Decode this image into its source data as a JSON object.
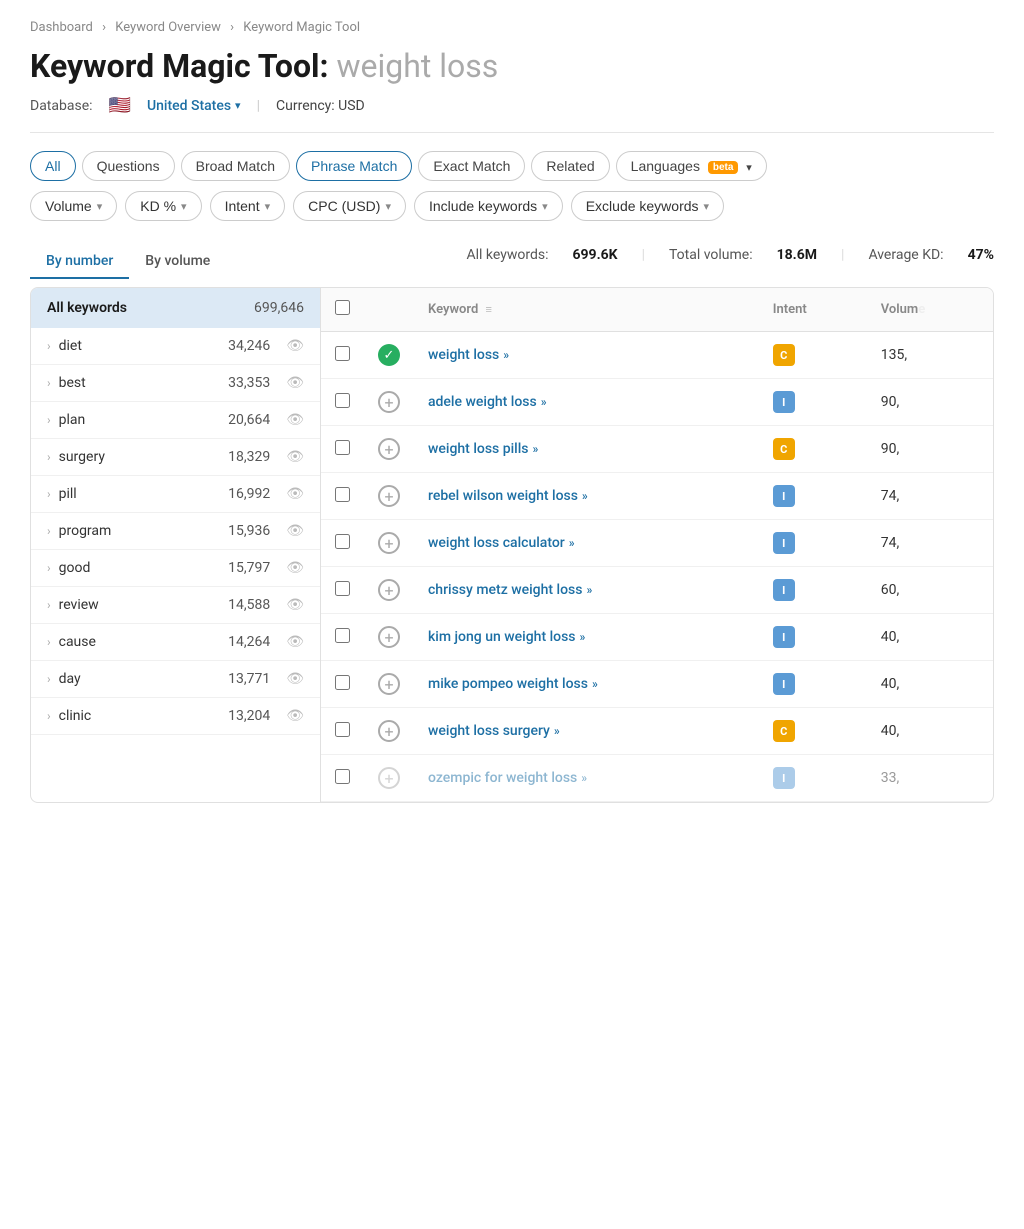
{
  "breadcrumb": {
    "items": [
      "Dashboard",
      "Keyword Overview",
      "Keyword Magic Tool"
    ]
  },
  "page": {
    "title": "Keyword Magic Tool:",
    "subtitle": "weight loss"
  },
  "database": {
    "label": "Database:",
    "country": "United States",
    "currency": "Currency: USD"
  },
  "tabs": [
    {
      "id": "all",
      "label": "All",
      "active": false,
      "all": true
    },
    {
      "id": "questions",
      "label": "Questions",
      "active": false
    },
    {
      "id": "broad-match",
      "label": "Broad Match",
      "active": false
    },
    {
      "id": "phrase-match",
      "label": "Phrase Match",
      "active": true
    },
    {
      "id": "exact-match",
      "label": "Exact Match",
      "active": false
    },
    {
      "id": "related",
      "label": "Related",
      "active": false
    },
    {
      "id": "languages",
      "label": "Languages",
      "active": false,
      "beta": true,
      "chevron": true
    }
  ],
  "filters": [
    {
      "id": "volume",
      "label": "Volume"
    },
    {
      "id": "kd",
      "label": "KD %"
    },
    {
      "id": "intent",
      "label": "Intent"
    },
    {
      "id": "cpc",
      "label": "CPC (USD)"
    },
    {
      "id": "include",
      "label": "Include keywords"
    },
    {
      "id": "exclude",
      "label": "Exclude keywords"
    }
  ],
  "stats": {
    "keywords_label": "All keywords:",
    "keywords_value": "699.6K",
    "volume_label": "Total volume:",
    "volume_value": "18.6M",
    "kd_label": "Average KD:",
    "kd_value": "47%"
  },
  "view_tabs": [
    {
      "id": "by-number",
      "label": "By number",
      "active": true
    },
    {
      "id": "by-volume",
      "label": "By volume",
      "active": false
    }
  ],
  "sidebar": {
    "header_label": "All keywords",
    "header_count": "699,646",
    "items": [
      {
        "name": "diet",
        "count": "34,246"
      },
      {
        "name": "best",
        "count": "33,353"
      },
      {
        "name": "plan",
        "count": "20,664"
      },
      {
        "name": "surgery",
        "count": "18,329"
      },
      {
        "name": "pill",
        "count": "16,992"
      },
      {
        "name": "program",
        "count": "15,936"
      },
      {
        "name": "good",
        "count": "15,797"
      },
      {
        "name": "review",
        "count": "14,588"
      },
      {
        "name": "cause",
        "count": "14,264"
      },
      {
        "name": "day",
        "count": "13,771"
      },
      {
        "name": "clinic",
        "count": "13,204"
      }
    ]
  },
  "table": {
    "columns": [
      "",
      "",
      "Keyword",
      "Intent",
      "Volume"
    ],
    "rows": [
      {
        "id": 1,
        "keyword": "weight loss",
        "intent": "C",
        "intent_class": "intent-c",
        "volume": "135,",
        "checked": false,
        "has_check": true
      },
      {
        "id": 2,
        "keyword": "adele weight loss",
        "intent": "I",
        "intent_class": "intent-i",
        "volume": "90,",
        "checked": false,
        "has_check": false
      },
      {
        "id": 3,
        "keyword": "weight loss pills",
        "intent": "C",
        "intent_class": "intent-c",
        "volume": "90,",
        "checked": false,
        "has_check": false
      },
      {
        "id": 4,
        "keyword": "rebel wilson weight loss",
        "intent": "I",
        "intent_class": "intent-i",
        "volume": "74,",
        "checked": false,
        "has_check": false
      },
      {
        "id": 5,
        "keyword": "weight loss calculator",
        "intent": "I",
        "intent_class": "intent-i",
        "volume": "74,",
        "checked": false,
        "has_check": false
      },
      {
        "id": 6,
        "keyword": "chrissy metz weight loss",
        "intent": "I",
        "intent_class": "intent-i",
        "volume": "60,",
        "checked": false,
        "has_check": false
      },
      {
        "id": 7,
        "keyword": "kim jong un weight loss",
        "intent": "I",
        "intent_class": "intent-i",
        "volume": "40,",
        "checked": false,
        "has_check": false
      },
      {
        "id": 8,
        "keyword": "mike pompeo weight loss",
        "intent": "I",
        "intent_class": "intent-i",
        "volume": "40,",
        "checked": false,
        "has_check": false
      },
      {
        "id": 9,
        "keyword": "weight loss surgery",
        "intent": "C",
        "intent_class": "intent-c",
        "volume": "40,",
        "checked": false,
        "has_check": false
      },
      {
        "id": 10,
        "keyword": "ozempic for weight loss",
        "intent": "I",
        "intent_class": "intent-i",
        "volume": "33,",
        "checked": false,
        "has_check": false,
        "faded": true
      }
    ]
  }
}
